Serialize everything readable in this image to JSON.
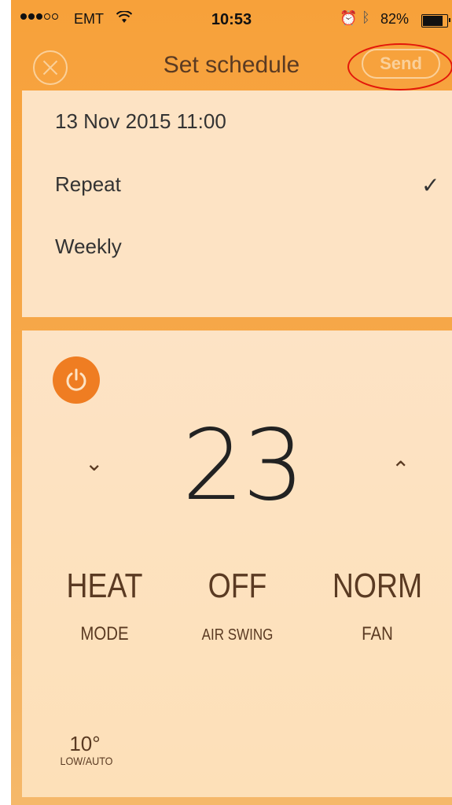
{
  "status_bar": {
    "carrier": "EMT",
    "time": "10:53",
    "battery_percent": "82%",
    "battery_level": 0.82
  },
  "nav": {
    "title": "Set schedule",
    "send_label": "Send"
  },
  "schedule": {
    "datetime": "13 Nov 2015 11:00",
    "repeat_label": "Repeat",
    "repeat_checked": true,
    "frequency": "Weekly"
  },
  "climate": {
    "temperature": "23",
    "mode_value": "HEAT",
    "mode_label": "MODE",
    "swing_value": "OFF",
    "swing_label": "AIR SWING",
    "fan_value": "NORM",
    "fan_label": "FAN",
    "setback_value": "10°",
    "setback_label": "LOW/AUTO"
  },
  "colors": {
    "accent": "#ef7d22",
    "highlight": "#e3170a",
    "panel": "#fde3c4"
  }
}
